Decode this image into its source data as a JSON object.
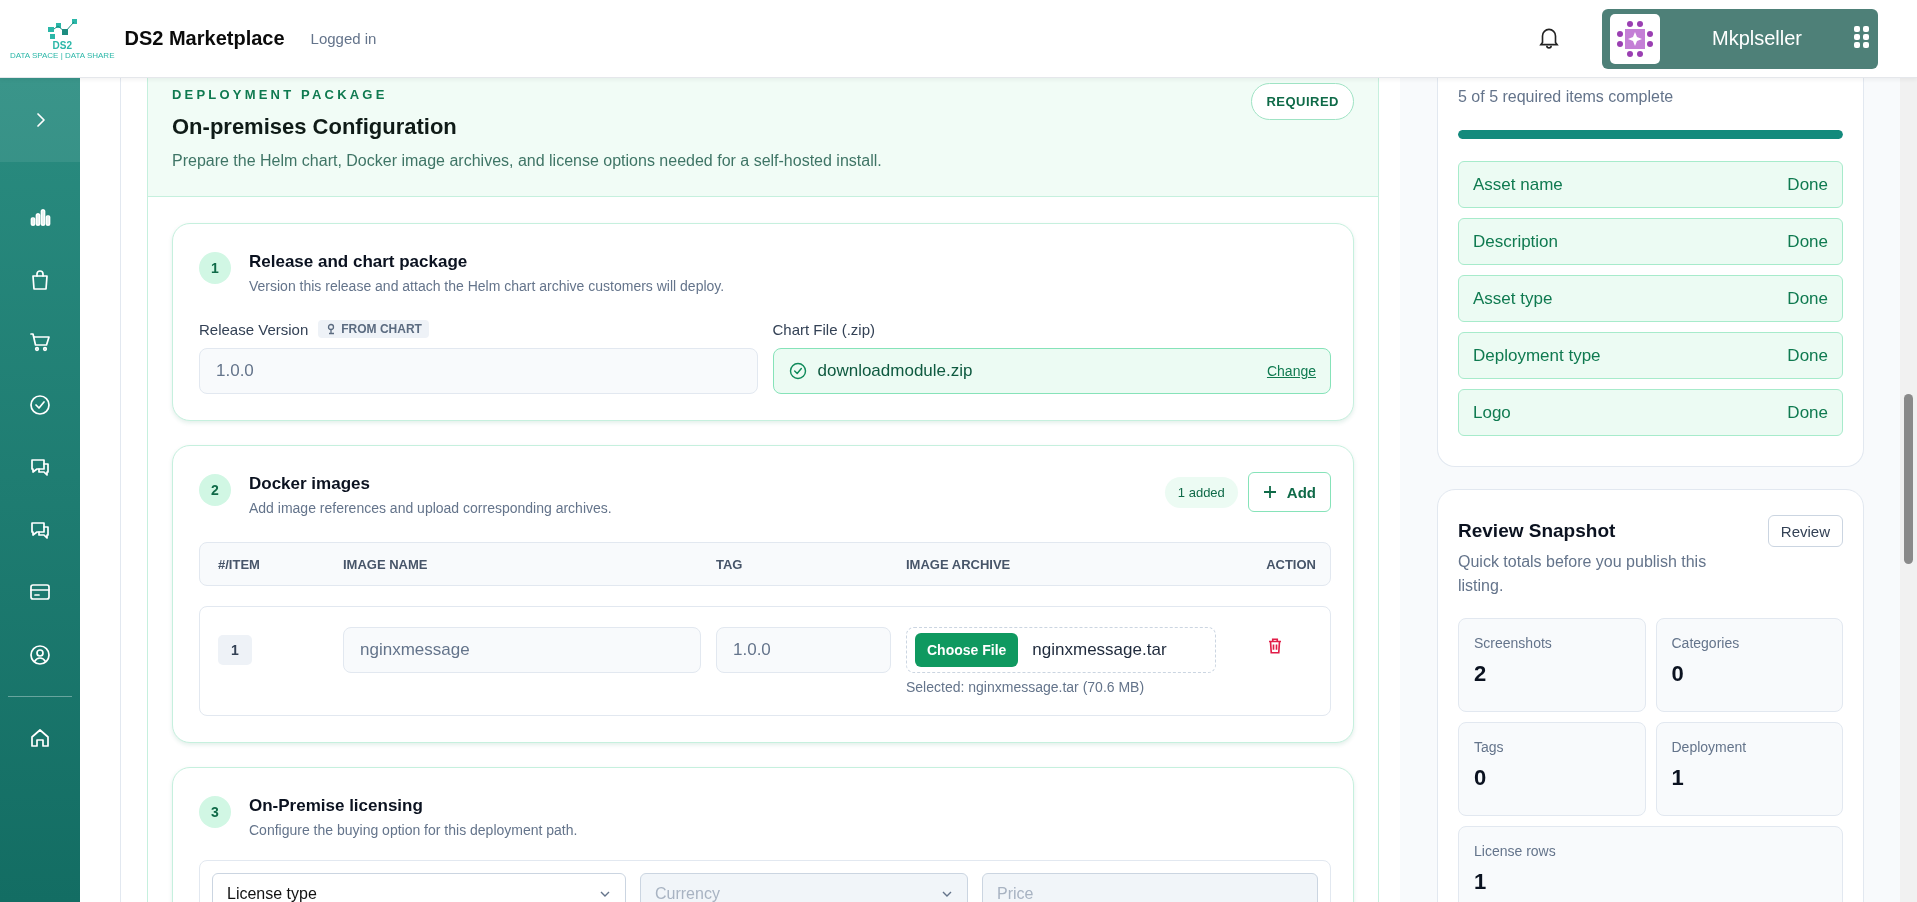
{
  "header": {
    "logo_text": "DS2",
    "logo_tagline": "DATA SPACE | DATA SHARE",
    "app_title": "DS2 Marketplace",
    "status": "Logged in",
    "user_name": "Mkplseller"
  },
  "deployment": {
    "eyebrow": "DEPLOYMENT PACKAGE",
    "title": "On-premises Configuration",
    "description": "Prepare the Helm chart, Docker image archives, and license options needed for a self-hosted install.",
    "badge": "REQUIRED",
    "steps": [
      {
        "kind": "release",
        "number": "1",
        "title": "Release and chart package",
        "description": "Version this release and attach the Helm chart archive customers will deploy.",
        "release_version": {
          "label": "Release Version",
          "tag": "FROM CHART",
          "value": "1.0.0"
        },
        "chart_file": {
          "label": "Chart File (.zip)",
          "file_name": "downloadmodule.zip",
          "uploaded": true,
          "action": "Change"
        }
      },
      {
        "kind": "images",
        "number": "2",
        "title": "Docker images",
        "description": "Add image references and upload corresponding archives.",
        "count_badge": "1 added",
        "add_button": "Add",
        "columns": [
          "#/ITEM",
          "IMAGE NAME",
          "TAG",
          "IMAGE ARCHIVE",
          "ACTION"
        ],
        "rows": [
          {
            "index": "1",
            "image_name": "nginxmessage",
            "tag": "1.0.0",
            "choose_button": "Choose File",
            "file_name": "nginxmessage.tar",
            "selected_note": "Selected: nginxmessage.tar (70.6 MB)"
          }
        ]
      },
      {
        "kind": "licensing",
        "number": "3",
        "title": "On-Premise licensing",
        "description": "Configure the buying option for this deployment path.",
        "fields": [
          {
            "kind": "select",
            "text": "License type",
            "disabled": false
          },
          {
            "kind": "select",
            "text": "Currency",
            "disabled": true
          },
          {
            "kind": "input",
            "text": "Price",
            "disabled": true
          }
        ]
      }
    ]
  },
  "checklist": {
    "summary": "5 of 5 required items complete",
    "level": 1,
    "items": [
      {
        "label": "Asset name",
        "status": "Done",
        "done": true
      },
      {
        "label": "Description",
        "status": "Done",
        "done": true
      },
      {
        "label": "Asset type",
        "status": "Done",
        "done": true
      },
      {
        "label": "Deployment type",
        "status": "Done",
        "done": true
      },
      {
        "label": "Logo",
        "status": "Done",
        "done": true
      }
    ]
  },
  "review": {
    "title": "Review Snapshot",
    "description": "Quick totals before you publish this listing.",
    "button": "Review",
    "stats": [
      {
        "label": "Screenshots",
        "value": "2"
      },
      {
        "label": "Categories",
        "value": "0"
      },
      {
        "label": "Tags",
        "value": "0"
      },
      {
        "label": "Deployment",
        "value": "1"
      },
      {
        "label": "License rows",
        "value": "1"
      }
    ]
  }
}
